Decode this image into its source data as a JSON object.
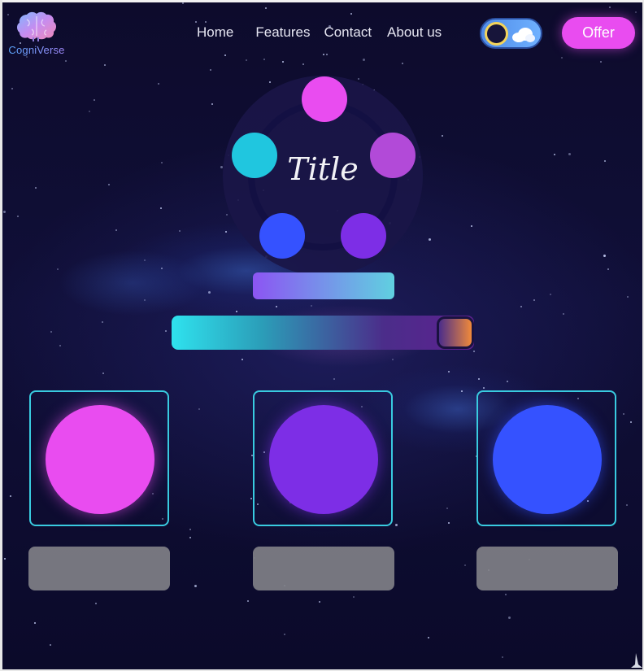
{
  "brand": {
    "name": "CogniVerse",
    "logo_icon": "brain-icon"
  },
  "nav": {
    "items": [
      "Home",
      "Features",
      "Contact",
      "About us"
    ]
  },
  "theme_toggle": {
    "state": "dark",
    "icons": [
      "moon-icon",
      "cloud-icon"
    ]
  },
  "offer_button": {
    "label": "Offer"
  },
  "hero": {
    "title": "Title",
    "orbit_dots": [
      "#e94cf0",
      "#b24ad8",
      "#7d2ee6",
      "#3552ff",
      "#20c6df"
    ]
  },
  "colors": {
    "background": "#0c0a2a",
    "accent_pink": "#e94cf0",
    "accent_purple": "#7d2ee6",
    "accent_blue": "#3552ff",
    "accent_cyan": "#39cbe0"
  },
  "cards": [
    {
      "color": "#e94cf0"
    },
    {
      "color": "#7d2ee6"
    },
    {
      "color": "#3552ff"
    }
  ]
}
